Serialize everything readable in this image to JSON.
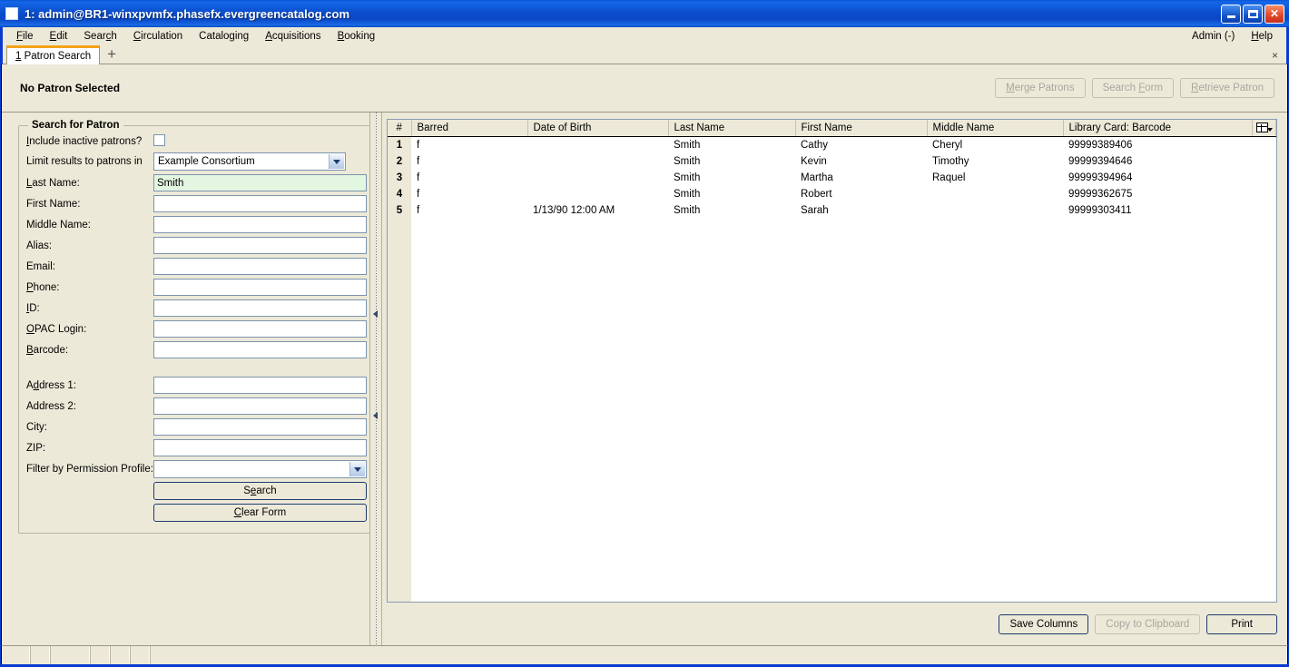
{
  "window": {
    "title": "1: admin@BR1-winxpvmfx.phasefx.evergreencatalog.com",
    "minimize_label": "Minimize",
    "maximize_label": "Maximize",
    "close_label": "✕"
  },
  "menubar": {
    "items": [
      {
        "label": "File",
        "accel": "F"
      },
      {
        "label": "Edit",
        "accel": "E"
      },
      {
        "label": "Search",
        "accel": "c"
      },
      {
        "label": "Circulation",
        "accel": "C"
      },
      {
        "label": "Cataloging",
        "accel": "g"
      },
      {
        "label": "Acquisitions",
        "accel": "A"
      },
      {
        "label": "Booking",
        "accel": "B"
      }
    ],
    "right": [
      {
        "label": "Admin (-)"
      },
      {
        "label": "Help",
        "accel": "H"
      }
    ]
  },
  "tabs": {
    "items": [
      {
        "label": "1 Patron Search",
        "active": true
      }
    ],
    "add_label": "+",
    "close_label": "×"
  },
  "patron_bar": {
    "title": "No Patron Selected",
    "buttons": [
      {
        "label": "Merge Patrons",
        "disabled": true
      },
      {
        "label": "Search Form",
        "disabled": true
      },
      {
        "label": "Retrieve Patron",
        "disabled": true
      }
    ]
  },
  "search_form": {
    "legend": "Search for Patron",
    "include_inactive_label": "Include inactive patrons?",
    "include_inactive_checked": false,
    "limit_results_label": "Limit results to patrons in",
    "limit_results_value": "Example Consortium",
    "fields": [
      {
        "label": "Last Name:",
        "value": "Smith",
        "focused": true
      },
      {
        "label": "First Name:",
        "value": ""
      },
      {
        "label": "Middle Name:",
        "value": ""
      },
      {
        "label": "Alias:",
        "value": ""
      },
      {
        "label": "Email:",
        "value": ""
      },
      {
        "label": "Phone:",
        "value": ""
      },
      {
        "label": "ID:",
        "value": ""
      },
      {
        "label": "OPAC Login:",
        "value": ""
      },
      {
        "label": "Barcode:",
        "value": ""
      }
    ],
    "address_fields": [
      {
        "label": "Address 1:",
        "value": ""
      },
      {
        "label": "Address 2:",
        "value": ""
      },
      {
        "label": "City:",
        "value": ""
      },
      {
        "label": "ZIP:",
        "value": ""
      }
    ],
    "permission_profile_label": "Filter by Permission Profile:",
    "permission_profile_value": "",
    "search_button": "Search",
    "clear_button": "Clear Form"
  },
  "results": {
    "columns": [
      "#",
      "Barred",
      "Date of Birth",
      "Last Name",
      "First Name",
      "Middle Name",
      "Library Card: Barcode"
    ],
    "column_picker_icon": "column-picker-icon",
    "rows": [
      {
        "num": "1",
        "barred": "f",
        "dob": "",
        "last": "Smith",
        "first": "Cathy",
        "middle": "Cheryl",
        "barcode": "99999389406"
      },
      {
        "num": "2",
        "barred": "f",
        "dob": "",
        "last": "Smith",
        "first": "Kevin",
        "middle": "Timothy",
        "barcode": "99999394646"
      },
      {
        "num": "3",
        "barred": "f",
        "dob": "",
        "last": "Smith",
        "first": "Martha",
        "middle": "Raquel",
        "barcode": "99999394964"
      },
      {
        "num": "4",
        "barred": "f",
        "dob": "",
        "last": "Smith",
        "first": "Robert",
        "middle": "",
        "barcode": "99999362675"
      },
      {
        "num": "5",
        "barred": "f",
        "dob": "1/13/90 12:00 AM",
        "last": "Smith",
        "first": "Sarah",
        "middle": "",
        "barcode": "99999303411"
      }
    ],
    "footer_buttons": [
      {
        "label": "Save Columns",
        "disabled": false
      },
      {
        "label": "Copy to Clipboard",
        "disabled": true
      },
      {
        "label": "Print",
        "disabled": false
      }
    ]
  },
  "statusbar": {
    "cells": [
      "",
      "",
      "",
      "",
      "",
      "",
      ""
    ]
  },
  "colors": {
    "titlebar_blue": "#0a47c5",
    "chrome_beige": "#ece9d8",
    "tab_accent": "#f5a31a",
    "field_focus_green": "#e3f6e0",
    "field_border": "#7d94ae",
    "button_border": "#1d3c6e"
  }
}
